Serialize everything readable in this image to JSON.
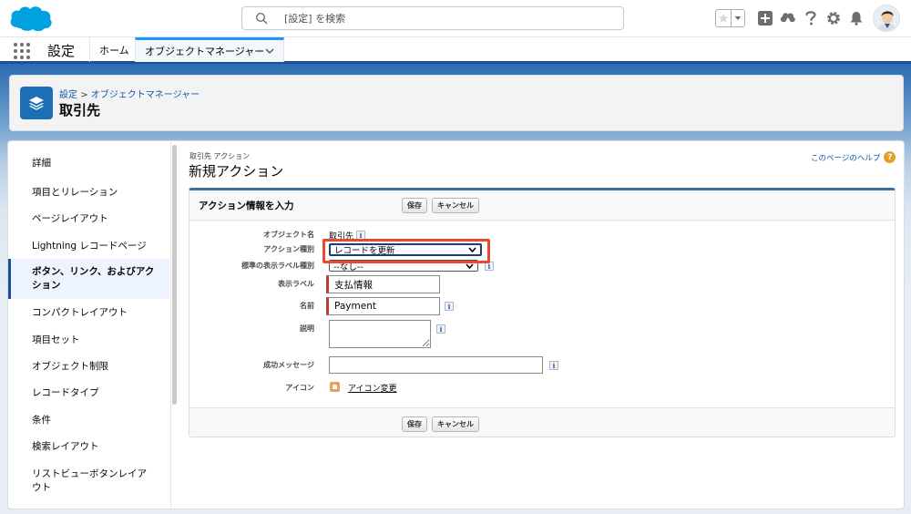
{
  "header": {
    "search_placeholder": "[設定] を検索"
  },
  "app_bar": {
    "app_name": "設定",
    "tabs": [
      {
        "label": "ホーム"
      },
      {
        "label": "オブジェクトマネージャー"
      }
    ]
  },
  "page_header": {
    "breadcrumb_root": "設定",
    "breadcrumb_separator": ">",
    "breadcrumb_current": "オブジェクトマネージャー",
    "title": "取引先"
  },
  "sidebar": {
    "items": [
      {
        "label": "詳細"
      },
      {
        "label": "項目とリレーション"
      },
      {
        "label": "ページレイアウト"
      },
      {
        "label": "Lightning レコードページ"
      },
      {
        "label": "ボタン、リンク、およびアクション"
      },
      {
        "label": "コンパクトレイアウト"
      },
      {
        "label": "項目セット"
      },
      {
        "label": "オブジェクト制限"
      },
      {
        "label": "レコードタイプ"
      },
      {
        "label": "条件"
      },
      {
        "label": "検索レイアウト"
      },
      {
        "label": "リストビューボタンレイアウト"
      }
    ],
    "active_index": 4
  },
  "main": {
    "pre_title": "取引先 アクション",
    "title": "新規アクション",
    "help_link": "このページのヘルプ",
    "panel": {
      "title": "アクション情報を入力",
      "save_button": "保存",
      "cancel_button": "キャンセル",
      "fields": {
        "object_name": {
          "label": "オブジェクト名",
          "value": "取引先"
        },
        "action_type": {
          "label": "アクション種別",
          "value": "レコードを更新"
        },
        "standard_label_type": {
          "label": "標準の表示ラベル種別",
          "value": "--なし--"
        },
        "display_label": {
          "label": "表示ラベル",
          "value": "支払情報"
        },
        "name": {
          "label": "名前",
          "value": "Payment"
        },
        "description": {
          "label": "説明",
          "value": ""
        },
        "success_message": {
          "label": "成功メッセージ",
          "value": ""
        },
        "icon": {
          "label": "アイコン",
          "link": "アイコン変更"
        }
      }
    }
  },
  "colors": {
    "brand_blue": "#1b5297",
    "highlight": "#e84a2b",
    "required": "#c23934",
    "link": "#0b5cab"
  }
}
